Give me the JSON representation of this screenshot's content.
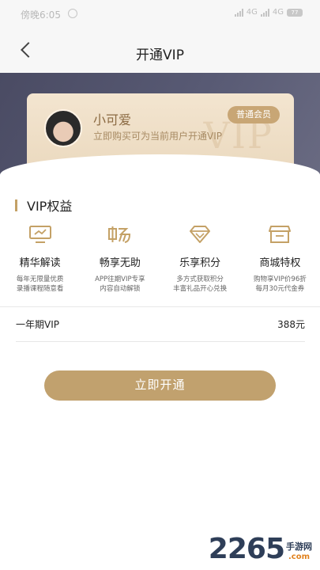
{
  "status_bar": {
    "time": "傍晚6:05",
    "network_1": "4G",
    "network_2": "4G",
    "battery": "77"
  },
  "nav": {
    "title": "开通VIP",
    "back_icon": "chevron-left-icon"
  },
  "card": {
    "user_name": "小可爱",
    "description": "立即购买可为当前用户开通VIP",
    "badge": "普通会员",
    "watermark": "VIP"
  },
  "benefits": {
    "title": "VIP权益",
    "items": [
      {
        "title": "精华解读",
        "desc1": "每年无限量优质",
        "desc2": "录播课程随意看",
        "icon": "tv-icon"
      },
      {
        "title": "畅享无助",
        "desc1": "APP往期VIP专享",
        "desc2": "内容自动解锁",
        "icon": "chang-character-icon"
      },
      {
        "title": "乐享积分",
        "desc1": "多方式获取积分",
        "desc2": "丰富礼品开心兑换",
        "icon": "diamond-icon"
      },
      {
        "title": "商城特权",
        "desc1": "购物享VIP价96折",
        "desc2": "每月30元代金券",
        "icon": "store-icon"
      }
    ]
  },
  "plan": {
    "name": "一年期VIP",
    "price": "388元"
  },
  "cta": {
    "label": "立即开通"
  },
  "site_watermark": {
    "number": "2265",
    "name": "手游网",
    "domain": ".com"
  },
  "colors": {
    "gold": "#c1a16e",
    "hero_dark": "#4a4b63",
    "card_bg": "#f3e5d0"
  }
}
